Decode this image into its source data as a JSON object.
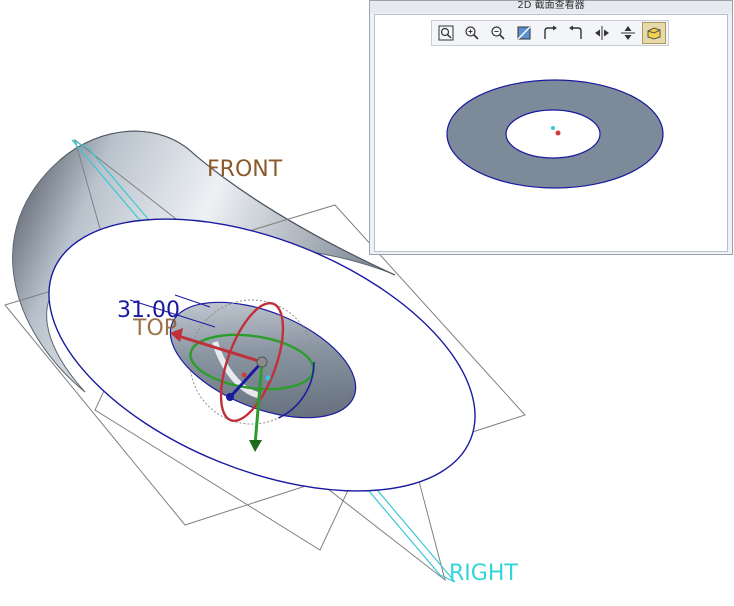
{
  "model_view": {
    "datum_planes": {
      "front": "FRONT",
      "top": "TOP",
      "right": "RIGHT"
    },
    "dimension_value": "31.00",
    "colors": {
      "shell": "#8a96a2",
      "edge": "#1a1aa0",
      "front_label": "#8b5a2b",
      "top_label": "#8b5a2b",
      "right_label": "#33d6d6",
      "dimension": "#1a1aa0",
      "handle_x": "#c0303a",
      "handle_y": "#2a9d2a",
      "handle_z": "#8a1c1c"
    }
  },
  "section_viewer": {
    "title": "2D 截面查看器",
    "toolbar": [
      {
        "name": "zoom-fit-icon",
        "active": false
      },
      {
        "name": "zoom-in-icon",
        "active": false
      },
      {
        "name": "zoom-out-icon",
        "active": false
      },
      {
        "name": "refit-icon",
        "active": false
      },
      {
        "name": "rotate-cw-icon",
        "active": false
      },
      {
        "name": "rotate-ccw-icon",
        "active": false
      },
      {
        "name": "flip-horizontal-icon",
        "active": false
      },
      {
        "name": "flip-vertical-icon",
        "active": false
      },
      {
        "name": "shading-icon",
        "active": true
      }
    ],
    "colors": {
      "ring_fill": "#7d8a9a",
      "ring_edge": "#1a1aa0"
    }
  }
}
